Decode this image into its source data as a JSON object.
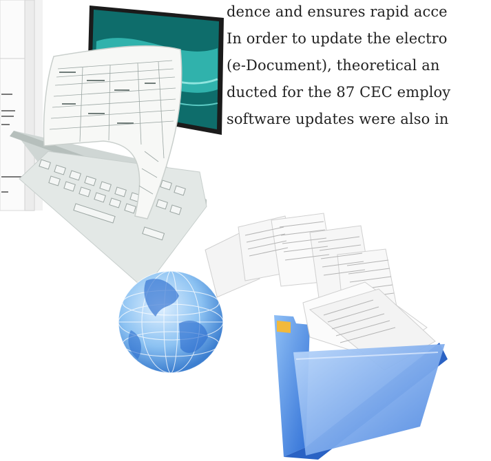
{
  "article": {
    "lines": [
      "dence and ensures rapid acce",
      "In order to update the electro",
      "(e-Document), theoretical an",
      "ducted for the 87 CEC employ",
      "software updates were also in"
    ]
  },
  "illustrations": {
    "top": {
      "name": "form-keyboard-monitor",
      "colors": {
        "screen": "#0e6d6b",
        "screen_accent": "#3fd0c8",
        "keys": "#e3e8e6",
        "paper": "#f7f8f6"
      }
    },
    "bottom": {
      "name": "globe-documents-folder",
      "colors": {
        "globe": "#4a90e2",
        "folder": "#3a7de0",
        "folder_tab": "#f2b93b",
        "paper": "#f4f4f4"
      }
    }
  }
}
